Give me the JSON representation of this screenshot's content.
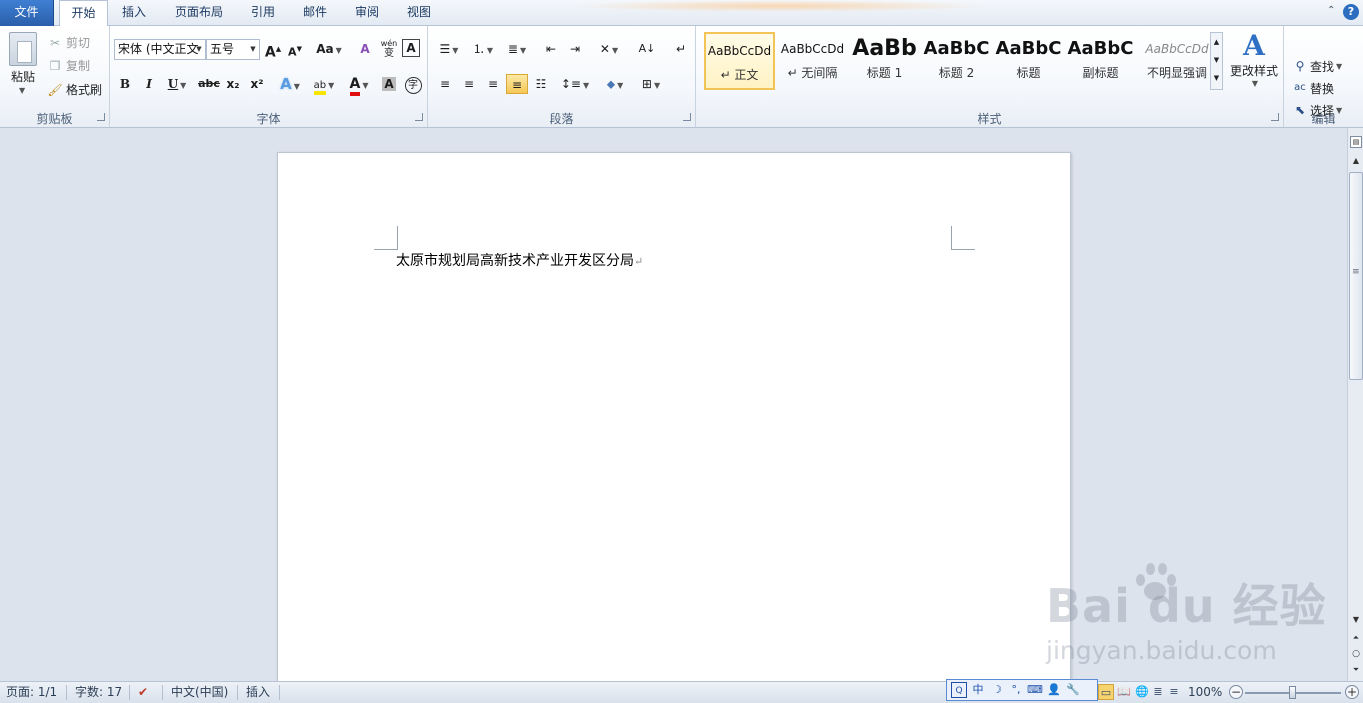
{
  "tabs": {
    "file": "文件",
    "home": "开始",
    "insert": "插入",
    "page_layout": "页面布局",
    "references": "引用",
    "mailings": "邮件",
    "review": "审阅",
    "view": "视图",
    "help_glyph": "?"
  },
  "ribbon": {
    "clipboard": {
      "label": "剪贴板",
      "paste": "粘贴",
      "cut": "剪切",
      "copy": "复制",
      "format_painter": "格式刷"
    },
    "font": {
      "label": "字体",
      "font_name": "宋体 (中文正文",
      "font_size": "五号",
      "grow_icon": "A",
      "shrink_icon": "A",
      "case_icon": "Aa",
      "clear_icon": "A",
      "bold": "B",
      "italic": "I",
      "underline": "U",
      "strike": "abc",
      "subscript": "x₂",
      "superscript": "x²",
      "text_effect_icon": "A",
      "highlight_icon": "ab",
      "font_color_icon": "A",
      "char_shading_icon": "A",
      "enclose_icon": "字",
      "pinyin_icon": "wén",
      "pinyin_char": "变",
      "highlight_color": "#f7e600",
      "font_color": "#e01010"
    },
    "paragraph": {
      "label": "段落"
    },
    "styles": {
      "label": "样式",
      "items": [
        {
          "sample": "AaBbCcDd",
          "name": "↵ 正文"
        },
        {
          "sample": "AaBbCcDd",
          "name": "↵ 无间隔"
        },
        {
          "sample": "AaBb",
          "name": "标题 1"
        },
        {
          "sample": "AaBbC",
          "name": "标题 2"
        },
        {
          "sample": "AaBbC",
          "name": "标题"
        },
        {
          "sample": "AaBbC",
          "name": "副标题"
        },
        {
          "sample": "AaBbCcDd",
          "name": "不明显强调"
        }
      ],
      "change_styles": "更改样式"
    },
    "editing": {
      "label": "编辑",
      "find": "查找",
      "replace": "替换",
      "select": "选择"
    }
  },
  "document": {
    "text": "太原市规划局高新技术产业开发区分局",
    "para_mark": "↵"
  },
  "status": {
    "page": "页面: 1/1",
    "words": "字数: 17",
    "language": "中文(中国)",
    "mode": "插入",
    "zoom": "100%",
    "zoom_minus": "−",
    "zoom_plus": "+",
    "zoom_level": 1.0
  },
  "ime": {
    "lang": "中"
  },
  "watermark": {
    "logo": "Bai du 经验",
    "url": "jingyan.baidu.com"
  },
  "colors": {
    "file_tab": "#2a5fab",
    "selected_style": "#f2c458",
    "ribbon_border": "#b6c3d6"
  }
}
